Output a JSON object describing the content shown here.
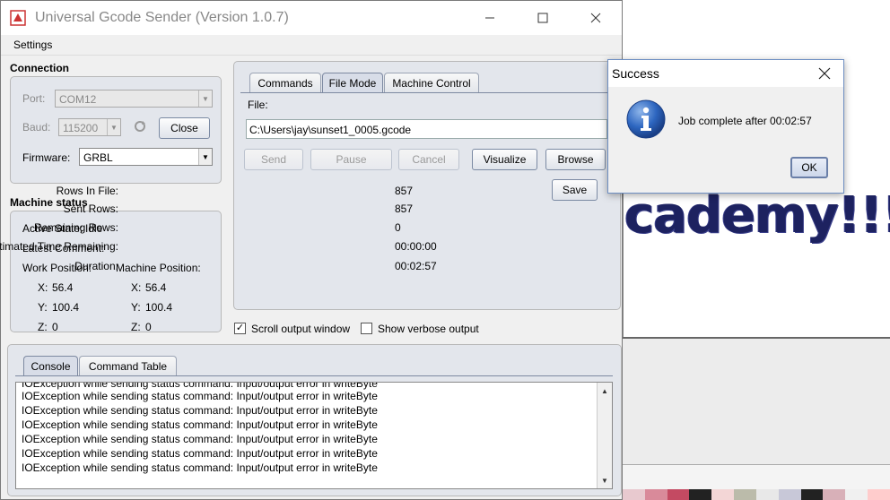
{
  "window": {
    "title": "Universal Gcode Sender (Version 1.0.7)",
    "minimize_icon": "minimize-icon",
    "maximize_icon": "maximize-icon",
    "close_icon": "close-icon"
  },
  "menu": {
    "settings": "Settings"
  },
  "connection": {
    "title": "Connection",
    "port_label": "Port:",
    "port_value": "COM12",
    "baud_label": "Baud:",
    "baud_value": "115200",
    "close_button": "Close",
    "firmware_label": "Firmware:",
    "firmware_value": "GRBL"
  },
  "machine_status": {
    "title": "Machine status",
    "active_state_label": "Active State:",
    "active_state_value": "Idle",
    "latest_comment_label": "Latest Comment:",
    "work_position_label": "Work Position:",
    "machine_position_label": "Machine Position:",
    "work": {
      "x_label": "X:",
      "x": "56.4",
      "y_label": "Y:",
      "y": "100.4",
      "z_label": "Z:",
      "z": "0"
    },
    "machine": {
      "x_label": "X:",
      "x": "56.4",
      "y_label": "Y:",
      "y": "100.4",
      "z_label": "Z:",
      "z": "0"
    }
  },
  "tabs": {
    "commands": "Commands",
    "file_mode": "File Mode",
    "machine_control": "Machine Control",
    "active": "File Mode"
  },
  "file_mode": {
    "file_label": "File:",
    "file_path": "C:\\Users\\jay\\sunset1_0005.gcode",
    "send": "Send",
    "pause": "Pause",
    "cancel": "Cancel",
    "visualize": "Visualize",
    "browse": "Browse",
    "save": "Save",
    "rows_in_file_label": "Rows In File:",
    "rows_in_file": "857",
    "sent_rows_label": "Sent Rows:",
    "sent_rows": "857",
    "remaining_rows_label": "Remaining Rows:",
    "remaining_rows": "0",
    "est_time_label": "Estimated Time Remaining:",
    "est_time": "00:00:00",
    "duration_label": "Duration:",
    "duration": "00:02:57"
  },
  "options": {
    "scroll_output": "Scroll output window",
    "scroll_output_checked": true,
    "verbose_output": "Show verbose output",
    "verbose_output_checked": false
  },
  "bottom_tabs": {
    "console": "Console",
    "command_table": "Command Table",
    "active": "Console"
  },
  "console_lines": [
    "IOException while sending status command: Input/output error in writeByte",
    "IOException while sending status command: Input/output error in writeByte",
    "IOException while sending status command: Input/output error in writeByte",
    "IOException while sending status command: Input/output error in writeByte",
    "IOException while sending status command: Input/output error in writeByte",
    "IOException while sending status command: Input/output error in writeByte",
    "IOException while sending status command: Input/output error in writeByte"
  ],
  "dialog": {
    "title": "Success",
    "message": "Job complete after 00:02:57",
    "ok": "OK",
    "icon": "info-icon"
  },
  "background_canvas_text": "cademy!!!",
  "colors": {
    "accent": "#3b6fd0",
    "panel": "#e3e6ec",
    "info_blue": "#1f5fb8"
  }
}
